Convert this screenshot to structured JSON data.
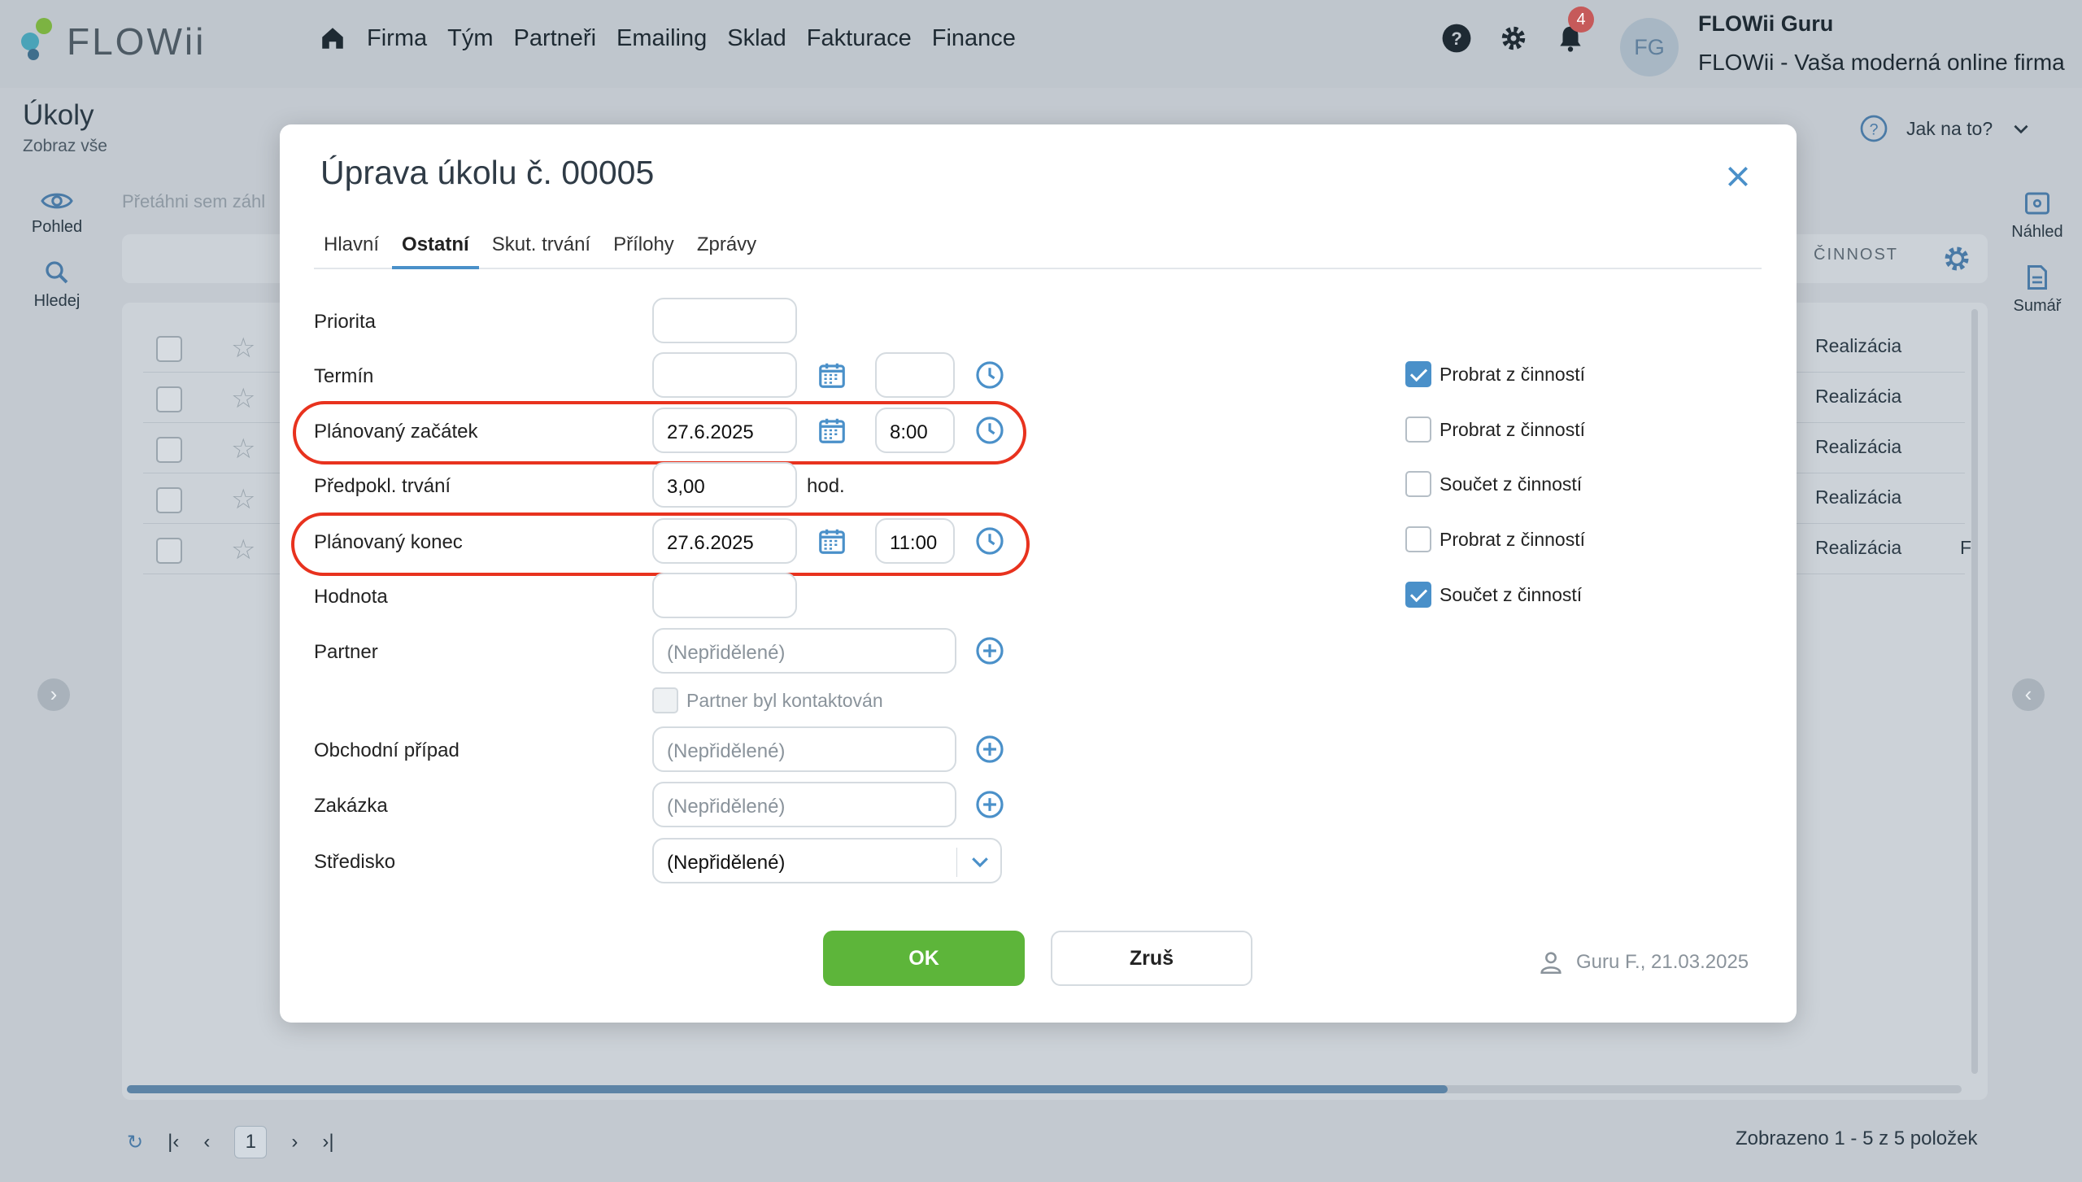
{
  "app": {
    "logo_text": "FLOWii",
    "nav": [
      "Firma",
      "Tým",
      "Partneři",
      "Emailing",
      "Sklad",
      "Fakturace",
      "Finance"
    ],
    "notifications_count": "4",
    "avatar_initials": "FG",
    "user_name": "FLOWii Guru",
    "company": "FLOWii - Vaša moderná online firma",
    "accent": "#4a90c9"
  },
  "page": {
    "title": "Úkoly",
    "subtitle": "Zobraz vše",
    "help_label": "Jak na to?",
    "drag_hint": "Přetáhni sem záhl",
    "column_cinnost": "ČINNOST",
    "left_rail": [
      {
        "label": "Pohled",
        "icon": "eye-icon"
      },
      {
        "label": "Hledej",
        "icon": "search-icon"
      }
    ],
    "right_rail": [
      {
        "label": "Náhled",
        "icon": "preview-icon"
      },
      {
        "label": "Sumář",
        "icon": "summary-icon"
      }
    ],
    "rows": [
      "Realizácia",
      "Realizácia",
      "Realizácia",
      "Realizácia",
      "Realizácia"
    ],
    "row_extra": "F",
    "pager": {
      "current_page": "1",
      "shown_text": "Zobrazeno 1 - 5 z 5 položek"
    }
  },
  "dialog": {
    "title": "Úprava úkolu č. 00005",
    "tabs": [
      "Hlavní",
      "Ostatní",
      "Skut. trvání",
      "Přílohy",
      "Zprávy"
    ],
    "active_tab": "Ostatní",
    "fields": {
      "priorita": {
        "label": "Priorita",
        "value": ""
      },
      "termin": {
        "label": "Termín",
        "date": "",
        "time": ""
      },
      "planovany_zacatek": {
        "label": "Plánovaný začátek",
        "date": "27.6.2025",
        "time": "8:00"
      },
      "predpokl_trvani": {
        "label": "Předpokl. trvání",
        "value": "3,00",
        "unit": "hod."
      },
      "planovany_konec": {
        "label": "Plánovaný konec",
        "date": "27.6.2025",
        "time": "11:00"
      },
      "hodnota": {
        "label": "Hodnota",
        "value": ""
      },
      "partner": {
        "label": "Partner",
        "placeholder": "(Nepřidělené)"
      },
      "partner_contacted": {
        "label": "Partner byl kontaktován",
        "checked": false
      },
      "obchodni_pripad": {
        "label": "Obchodní případ",
        "placeholder": "(Nepřidělené)"
      },
      "zakazka": {
        "label": "Zakázka",
        "placeholder": "(Nepřidělené)"
      },
      "stredisko": {
        "label": "Středisko",
        "value": "(Nepřidělené)"
      }
    },
    "checkboxes": [
      {
        "label": "Probrat z činností",
        "checked": true
      },
      {
        "label": "Probrat z činností",
        "checked": false
      },
      {
        "label": "Součet z činností",
        "checked": false
      },
      {
        "label": "Probrat z činností",
        "checked": false
      },
      {
        "label": "Součet z činností",
        "checked": true
      }
    ],
    "ok_label": "OK",
    "cancel_label": "Zruš",
    "author": "Guru F., 21.03.2025",
    "highlight_color": "#e8321e",
    "ok_color": "#5db53a"
  }
}
